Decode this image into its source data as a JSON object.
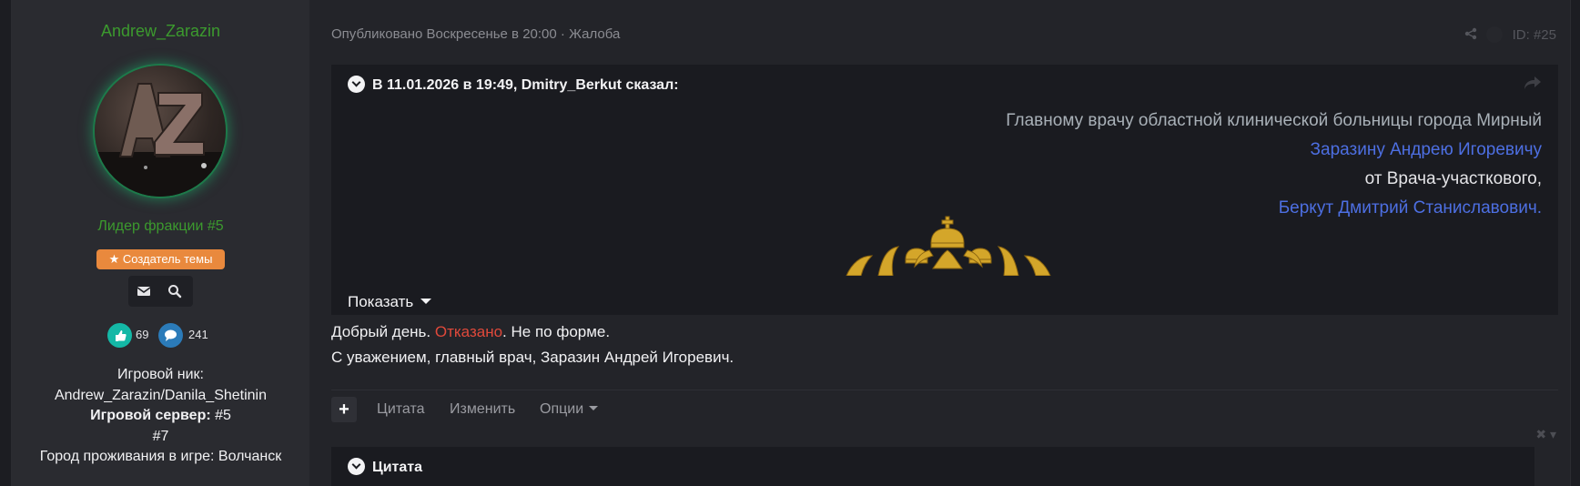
{
  "author": {
    "name": "Andrew_Zarazin",
    "avatar_initials": "AZ",
    "title": "Лидер фракции #5",
    "badge_label": "Создатель темы",
    "likes": "69",
    "posts": "241",
    "info": {
      "nick_label": "Игровой ник:",
      "nick_value": "Andrew_Zarazin/Danila_Shetinin",
      "server_label": "Игровой сервер:",
      "server_value": " #5",
      "server_value2": "#7",
      "city_line": "Город проживания в игре: Волчанск"
    },
    "icons": [
      "envelope-icon",
      "search-icon",
      "thumbs-up-icon",
      "comment-icon",
      "star-icon"
    ]
  },
  "post": {
    "published": "Опубликовано Воскресенье в 20:00",
    "separator": "·",
    "report": "Жалоба",
    "id": "ID: #25",
    "quote": {
      "header": "В 11.01.2026 в 19:49, Dmitry_Berkut сказал:",
      "line1": "Главному врачу областной клинической больницы города Мирный",
      "line2": "Заразину Андрею Игоревичу",
      "line3": "от Врача-участкового,",
      "line4": "Беркут Дмитрий Станиславович.",
      "show_more": "Показать"
    },
    "body": {
      "greeting": "Добрый день. ",
      "status": "Отказано",
      "after_status": ". Не по форме.",
      "signature": "С уважением, главный врач, Заразин Андрей Игоревич."
    },
    "actions": {
      "plus": "+",
      "quote": "Цитата",
      "edit": "Изменить",
      "options": "Опции"
    },
    "quote2_header": "Цитата"
  },
  "colors": {
    "background": "#1c1d22",
    "sidebar": "#2a2b30",
    "green": "#3c9a2e",
    "blue_link": "#4d6fe2",
    "rejected_red": "#e0493b",
    "badge_orange": "#e9893d"
  }
}
